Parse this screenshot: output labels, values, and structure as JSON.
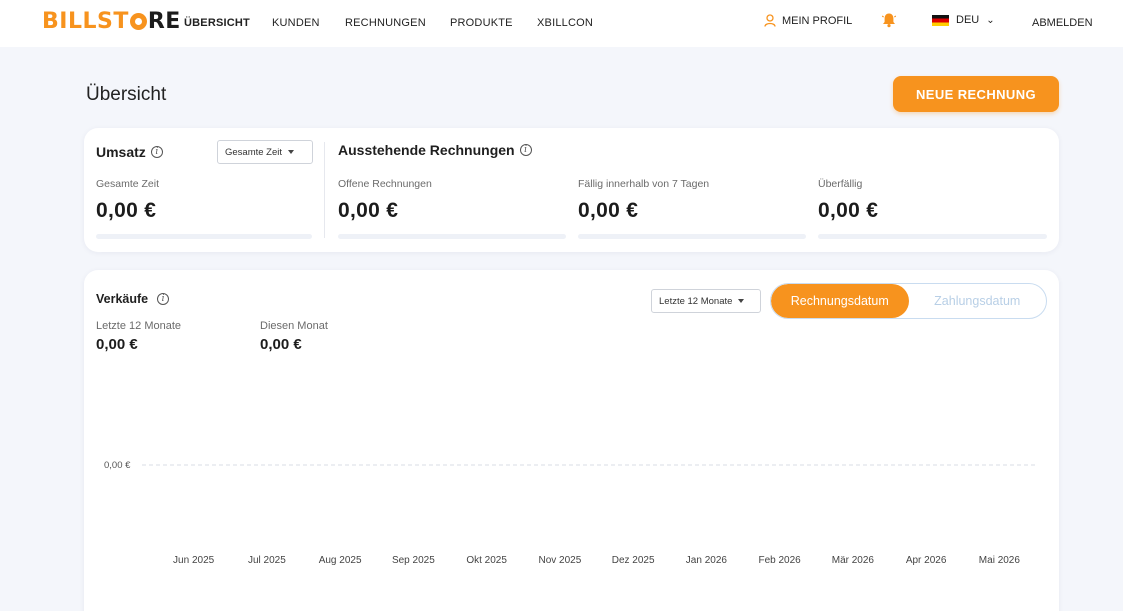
{
  "app": {
    "logo_text_pre": "BILLST",
    "logo_text_post": "RE",
    "brand_color": "#f7931e"
  },
  "nav": {
    "items": [
      "ÜBERSICHT",
      "KUNDEN",
      "RECHNUNGEN",
      "PRODUKTE",
      "XBILLCON"
    ],
    "active_index": 0,
    "profile_label": "MEIN PROFIL",
    "language_label": "DEU",
    "logout_label": "ABMELDEN"
  },
  "page": {
    "title": "Übersicht",
    "new_invoice_label": "NEUE RECHNUNG"
  },
  "revenue": {
    "title": "Umsatz",
    "period_select": "Gesamte Zeit",
    "label": "Gesamte Zeit",
    "value": "0,00 €"
  },
  "outstanding": {
    "title": "Ausstehende Rechnungen",
    "items": [
      {
        "label": "Offene Rechnungen",
        "value": "0,00 €"
      },
      {
        "label": "Fällig innerhalb von 7 Tagen",
        "value": "0,00 €"
      },
      {
        "label": "Überfällig",
        "value": "0,00 €"
      }
    ]
  },
  "sales": {
    "title": "Verkäufe",
    "period_select": "Letzte 12 Monate",
    "toggle": {
      "active": "Rechnungsdatum",
      "inactive": "Zahlungsdatum"
    },
    "stats": [
      {
        "label": "Letzte 12 Monate",
        "value": "0,00 €"
      },
      {
        "label": "Diesen Monat",
        "value": "0,00 €"
      }
    ]
  },
  "chart_data": {
    "type": "line",
    "title": "",
    "xlabel": "",
    "ylabel": "",
    "categories": [
      "Jun 2025",
      "Jul 2025",
      "Aug 2025",
      "Sep 2025",
      "Okt 2025",
      "Nov 2025",
      "Dez 2025",
      "Jan 2026",
      "Feb 2026",
      "Mär 2026",
      "Apr 2026",
      "Mai 2026"
    ],
    "series": [
      {
        "values": [
          0,
          0,
          0,
          0,
          0,
          0,
          0,
          0,
          0,
          0,
          0,
          0
        ]
      }
    ],
    "y_ticks": [
      "0,00 €"
    ],
    "grid": true
  }
}
